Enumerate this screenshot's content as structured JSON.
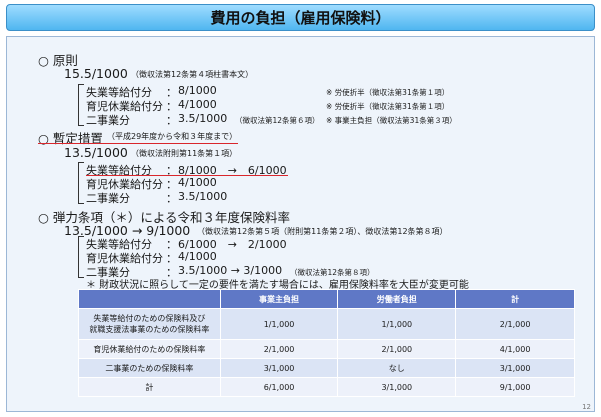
{
  "title": "費用の負担（雇用保険料）",
  "principle": {
    "heading": "○ 原則",
    "rate": "15.5/1000",
    "rate_note": "（徴収法第12条第４項柱書本文）",
    "rows": [
      {
        "label": "失業等給付分",
        "colon": "：",
        "value": "8/1000",
        "note": "※ 労使折半（徴収法第31条第１項）"
      },
      {
        "label": "育児休業給付分",
        "colon": "：",
        "value": "4/1000",
        "note": "※ 労使折半（徴収法第31条第１項）"
      },
      {
        "label": "二事業分",
        "colon": "：",
        "value": "3.5/1000",
        "note_inline": "（徴収法第12条第６項）",
        "note": "※ 事業主負担（徴収法第31条第３項）"
      }
    ]
  },
  "provisional": {
    "heading": "○ 暫定措置",
    "heading_note": "（平成29年度から令和３年度まで）",
    "rate": "13.5/1000",
    "rate_note": "（徴収法附則第11条第１項）",
    "rows": [
      {
        "label": "失業等給付分",
        "colon": "：",
        "value": "8/1000　→　6/1000"
      },
      {
        "label": "育児休業給付分",
        "colon": "：",
        "value": "4/1000"
      },
      {
        "label": "二事業分",
        "colon": "：",
        "value": "3.5/1000"
      }
    ]
  },
  "elastic": {
    "heading": "○ 弾力条項（＊）による令和３年度保険料率",
    "rate": "13.5/1000 → 9/1000",
    "rate_note": "（徴収法第12条第５項（附則第11条第２項）、徴収法第12条第８項）",
    "rows": [
      {
        "label": "失業等給付分",
        "colon": "：",
        "value": "6/1000　→　2/1000"
      },
      {
        "label": "育児休業給付分",
        "colon": "：",
        "value": "4/1000"
      },
      {
        "label": "二事業分",
        "colon": "：",
        "value": "3.5/1000 → 3/1000",
        "note_inline": "（徴収法第12条第８項）"
      }
    ],
    "footnote": "＊ 財政状況に照らして一定の要件を満たす場合には、雇用保険料率を大臣が変更可能"
  },
  "table": {
    "headers": [
      "",
      "事業主負担",
      "労働者負担",
      "計"
    ],
    "rows": [
      {
        "label_line1": "失業等給付のための保険料及び",
        "label_line2": "就職支援法事業のための保険料率",
        "cells": [
          "1/1,000",
          "1/1,000",
          "2/1,000"
        ]
      },
      {
        "label_line1": "育児休業給付のための保険料率",
        "label_line2": "",
        "cells": [
          "2/1,000",
          "2/1,000",
          "4/1,000"
        ]
      },
      {
        "label_line1": "二事業のための保険料率",
        "label_line2": "",
        "cells": [
          "3/1,000",
          "なし",
          "3/1,000"
        ]
      },
      {
        "label_line1": "計",
        "label_line2": "",
        "cells": [
          "6/1,000",
          "3/1,000",
          "9/1,000"
        ]
      }
    ]
  },
  "page_number": "12"
}
